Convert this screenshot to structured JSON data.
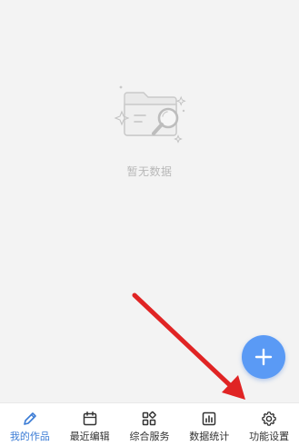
{
  "empty_state": {
    "icon": "empty-folder-search-icon",
    "text": "暂无数据"
  },
  "fab": {
    "icon": "plus-icon",
    "color": "#5a9af5"
  },
  "annotation": {
    "icon": "red-arrow-icon",
    "color": "#e02424"
  },
  "tabbar": {
    "active_color": "#3a7bd5",
    "items": [
      {
        "label": "我的作品",
        "icon": "pencil-icon",
        "active": true
      },
      {
        "label": "最近编辑",
        "icon": "calendar-icon",
        "active": false
      },
      {
        "label": "综合服务",
        "icon": "grid-icon",
        "active": false
      },
      {
        "label": "数据统计",
        "icon": "bar-chart-icon",
        "active": false
      },
      {
        "label": "功能设置",
        "icon": "gear-icon",
        "active": false
      }
    ]
  }
}
